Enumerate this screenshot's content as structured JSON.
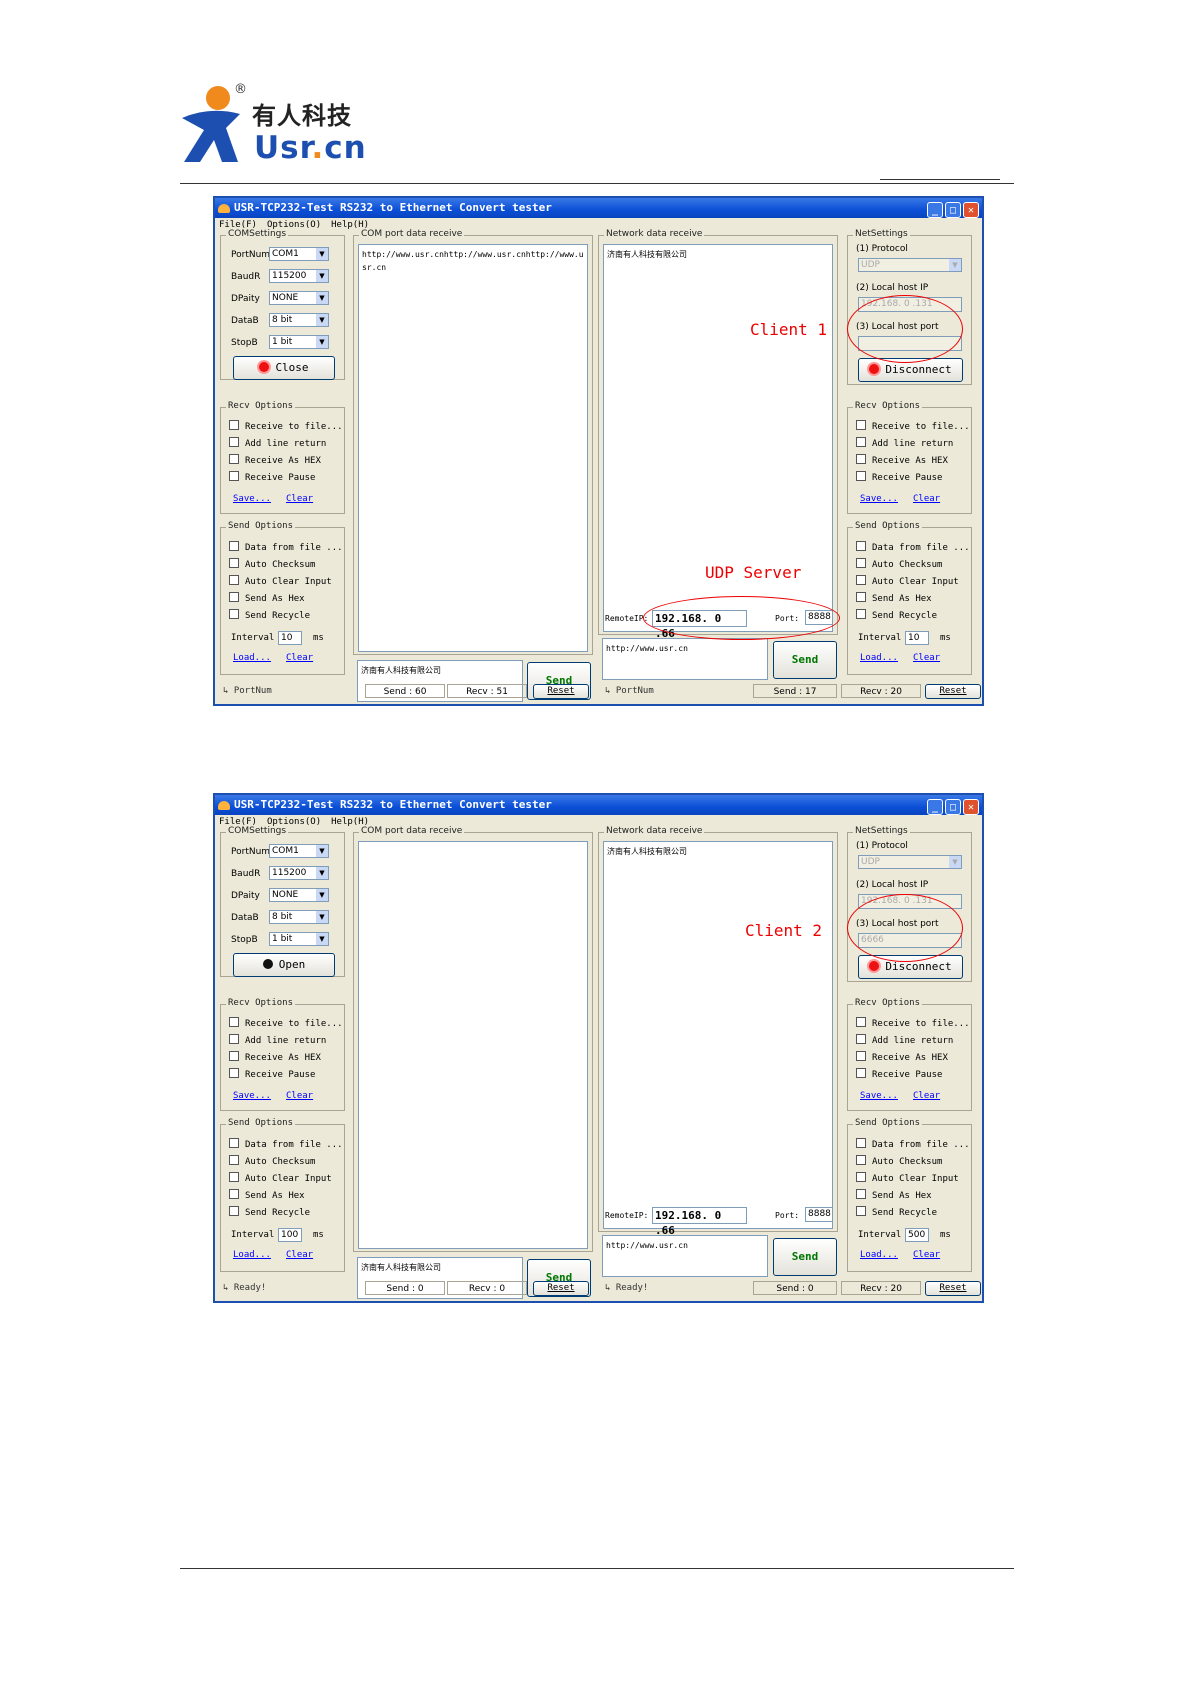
{
  "logo": {
    "chinese": "有人科技",
    "latin": "Usr.cn",
    "reg": "®"
  },
  "windows": [
    {
      "title": "USR-TCP232-Test   RS232 to Ethernet Convert tester",
      "menu": [
        "File(F)",
        "Options(O)",
        "Help(H)"
      ],
      "com_settings": {
        "label": "COMSettings",
        "portnum_label": "PortNum",
        "portnum": "COM1",
        "baud_label": "BaudR",
        "baud": "115200",
        "parity_label": "DPaity",
        "parity": "NONE",
        "databits_label": "DataB",
        "databits": "8 bit",
        "stopbits_label": "StopB",
        "stopbits": "1 bit",
        "button": "Close"
      },
      "recv_options": {
        "label": "Recv Options",
        "items": [
          "Receive to file...",
          "Add line return",
          "Receive As HEX",
          "Receive Pause"
        ],
        "save": "Save...",
        "clear": "Clear"
      },
      "send_options": {
        "label": "Send Options",
        "items": [
          "Data from file ...",
          "Auto Checksum",
          "Auto Clear Input",
          "Send As Hex",
          "Send Recycle"
        ],
        "interval_label": "Interval",
        "interval": "10",
        "interval_unit": "ms",
        "load": "Load...",
        "clear": "Clear"
      },
      "com_receive": {
        "label": "COM port data receive",
        "text": "http://www.usr.cnhttp://www.usr.cnhttp://www.usr.cn"
      },
      "com_send": {
        "text": "济南有人科技有限公司",
        "button": "Send"
      },
      "com_status": {
        "port": "PortNum",
        "send": "Send : 60",
        "recv": "Recv : 51",
        "reset": "Reset"
      },
      "net_receive": {
        "label": "Network data receive",
        "text": "济南有人科技有限公司"
      },
      "remote": {
        "ip_label": "RemoteIP:",
        "ip": "192.168. 0 .66",
        "port_label": "Port:",
        "port": "8888"
      },
      "net_send": {
        "text": "http://www.usr.cn",
        "button": "Send"
      },
      "net_status": {
        "port": "PortNum",
        "send": "Send : 17",
        "recv": "Recv : 20",
        "reset": "Reset"
      },
      "net_settings": {
        "label": "NetSettings",
        "protocol_label": "(1) Protocol",
        "protocol": "UDP",
        "local_ip_label": "(2) Local host IP",
        "local_ip": "192.168. 0 .131",
        "local_port_label": "(3) Local host port",
        "local_port": "",
        "button": "Disconnect"
      },
      "net_recv_options": {
        "label": "Recv Options",
        "items": [
          "Receive to file...",
          "Add line return",
          "Receive As HEX",
          "Receive Pause"
        ],
        "save": "Save...",
        "clear": "Clear"
      },
      "net_send_options": {
        "label": "Send Options",
        "items": [
          "Data from file ...",
          "Auto Checksum",
          "Auto Clear Input",
          "Send As Hex",
          "Send Recycle"
        ],
        "interval_label": "Interval",
        "interval": "10",
        "interval_unit": "ms",
        "load": "Load...",
        "clear": "Clear"
      },
      "annotations": {
        "client": "Client 1",
        "server": "UDP Server"
      }
    },
    {
      "title": "USR-TCP232-Test   RS232 to Ethernet Convert tester",
      "menu": [
        "File(F)",
        "Options(O)",
        "Help(H)"
      ],
      "com_settings": {
        "label": "COMSettings",
        "portnum_label": "PortNum",
        "portnum": "COM1",
        "baud_label": "BaudR",
        "baud": "115200",
        "parity_label": "DPaity",
        "parity": "NONE",
        "databits_label": "DataB",
        "databits": "8 bit",
        "stopbits_label": "StopB",
        "stopbits": "1 bit",
        "button": "Open"
      },
      "recv_options": {
        "label": "Recv Options",
        "items": [
          "Receive to file...",
          "Add line return",
          "Receive As HEX",
          "Receive Pause"
        ],
        "save": "Save...",
        "clear": "Clear"
      },
      "send_options": {
        "label": "Send Options",
        "items": [
          "Data from file ...",
          "Auto Checksum",
          "Auto Clear Input",
          "Send As Hex",
          "Send Recycle"
        ],
        "interval_label": "Interval",
        "interval": "100",
        "interval_unit": "ms",
        "load": "Load...",
        "clear": "Clear"
      },
      "com_receive": {
        "label": "COM port data receive",
        "text": ""
      },
      "com_send": {
        "text": "济南有人科技有限公司",
        "button": "Send"
      },
      "com_status": {
        "port": "Ready!",
        "send": "Send : 0",
        "recv": "Recv : 0",
        "reset": "Reset"
      },
      "net_receive": {
        "label": "Network data receive",
        "text": "济南有人科技有限公司"
      },
      "remote": {
        "ip_label": "RemoteIP:",
        "ip": "192.168. 0 .66",
        "port_label": "Port:",
        "port": "8888"
      },
      "net_send": {
        "text": "http://www.usr.cn",
        "button": "Send"
      },
      "net_status": {
        "port": "Ready!",
        "send": "Send : 0",
        "recv": "Recv : 20",
        "reset": "Reset"
      },
      "net_settings": {
        "label": "NetSettings",
        "protocol_label": "(1) Protocol",
        "protocol": "UDP",
        "local_ip_label": "(2) Local host IP",
        "local_ip": "192.168. 0 .131",
        "local_port_label": "(3) Local host port",
        "local_port": "6666",
        "button": "Disconnect"
      },
      "net_recv_options": {
        "label": "Recv Options",
        "items": [
          "Receive to file...",
          "Add line return",
          "Receive As HEX",
          "Receive Pause"
        ],
        "save": "Save...",
        "clear": "Clear"
      },
      "net_send_options": {
        "label": "Send Options",
        "items": [
          "Data from file ...",
          "Auto Checksum",
          "Auto Clear Input",
          "Send As Hex",
          "Send Recycle"
        ],
        "interval_label": "Interval",
        "interval": "500",
        "interval_unit": "ms",
        "load": "Load...",
        "clear": "Clear"
      },
      "annotations": {
        "client": "Client 2",
        "server": ""
      }
    }
  ]
}
